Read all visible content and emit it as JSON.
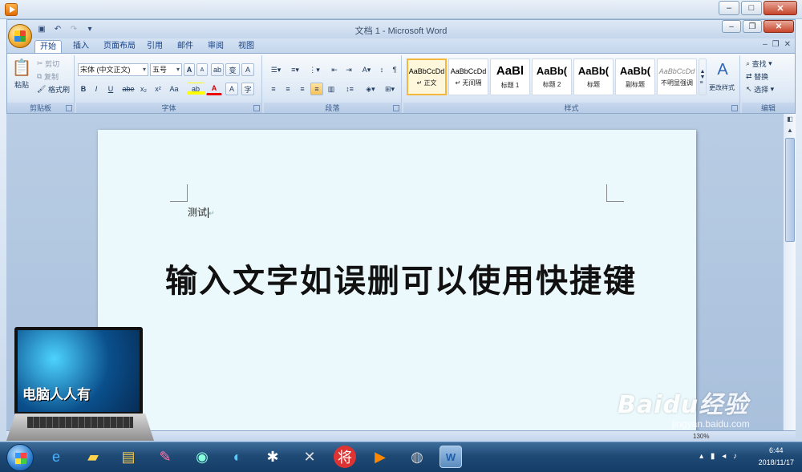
{
  "window": {
    "title": "文档 1 - Microsoft Word"
  },
  "quick_access": {
    "icons": [
      "save-icon",
      "undo-icon",
      "redo-icon"
    ]
  },
  "tabs": [
    "开始",
    "插入",
    "页面布局",
    "引用",
    "邮件",
    "审阅",
    "视图"
  ],
  "ribbon": {
    "clipboard": {
      "paste": "粘贴",
      "cut": "剪切",
      "copy": "复制",
      "format_painter": "格式刷",
      "label": "剪贴板"
    },
    "font": {
      "font_name": "宋体 (中文正文)",
      "font_size": "五号",
      "label": "字体",
      "bold": "B",
      "italic": "I",
      "underline": "U",
      "strike": "abe",
      "sub": "x₂",
      "sup": "x²",
      "case": "Aa",
      "grow": "A",
      "shrink": "A",
      "clear": "ab",
      "phonetic": "变",
      "border": "A",
      "color": "A",
      "shade": "A",
      "char": "字"
    },
    "paragraph": {
      "label": "段落"
    },
    "styles": {
      "label": "样式",
      "items": [
        {
          "sample": "AaBbCcDd",
          "name": "↵ 正文"
        },
        {
          "sample": "AaBbCcDd",
          "name": "↵ 无间隔"
        },
        {
          "sample": "AaBl",
          "name": "标题 1"
        },
        {
          "sample": "AaBb(",
          "name": "标题 2"
        },
        {
          "sample": "AaBb(",
          "name": "标题"
        },
        {
          "sample": "AaBb(",
          "name": "副标题"
        },
        {
          "sample": "AaBbCcDd",
          "name": "不明显强调"
        }
      ],
      "change_styles": "更改样式"
    },
    "editing": {
      "find": "查找",
      "replace": "替换",
      "select": "选择",
      "label": "编辑"
    }
  },
  "document": {
    "typed_text": "测试",
    "caption": "输入文字如误删可以使用快捷键"
  },
  "status": {
    "zoom": "130%"
  },
  "overlay": {
    "laptop_brand": "电脑人人有",
    "watermark_logo": "Baidu经验",
    "watermark_url": "jingyan.baidu.com"
  },
  "taskbar": {
    "time": "6:44",
    "date": "2018/11/17"
  }
}
